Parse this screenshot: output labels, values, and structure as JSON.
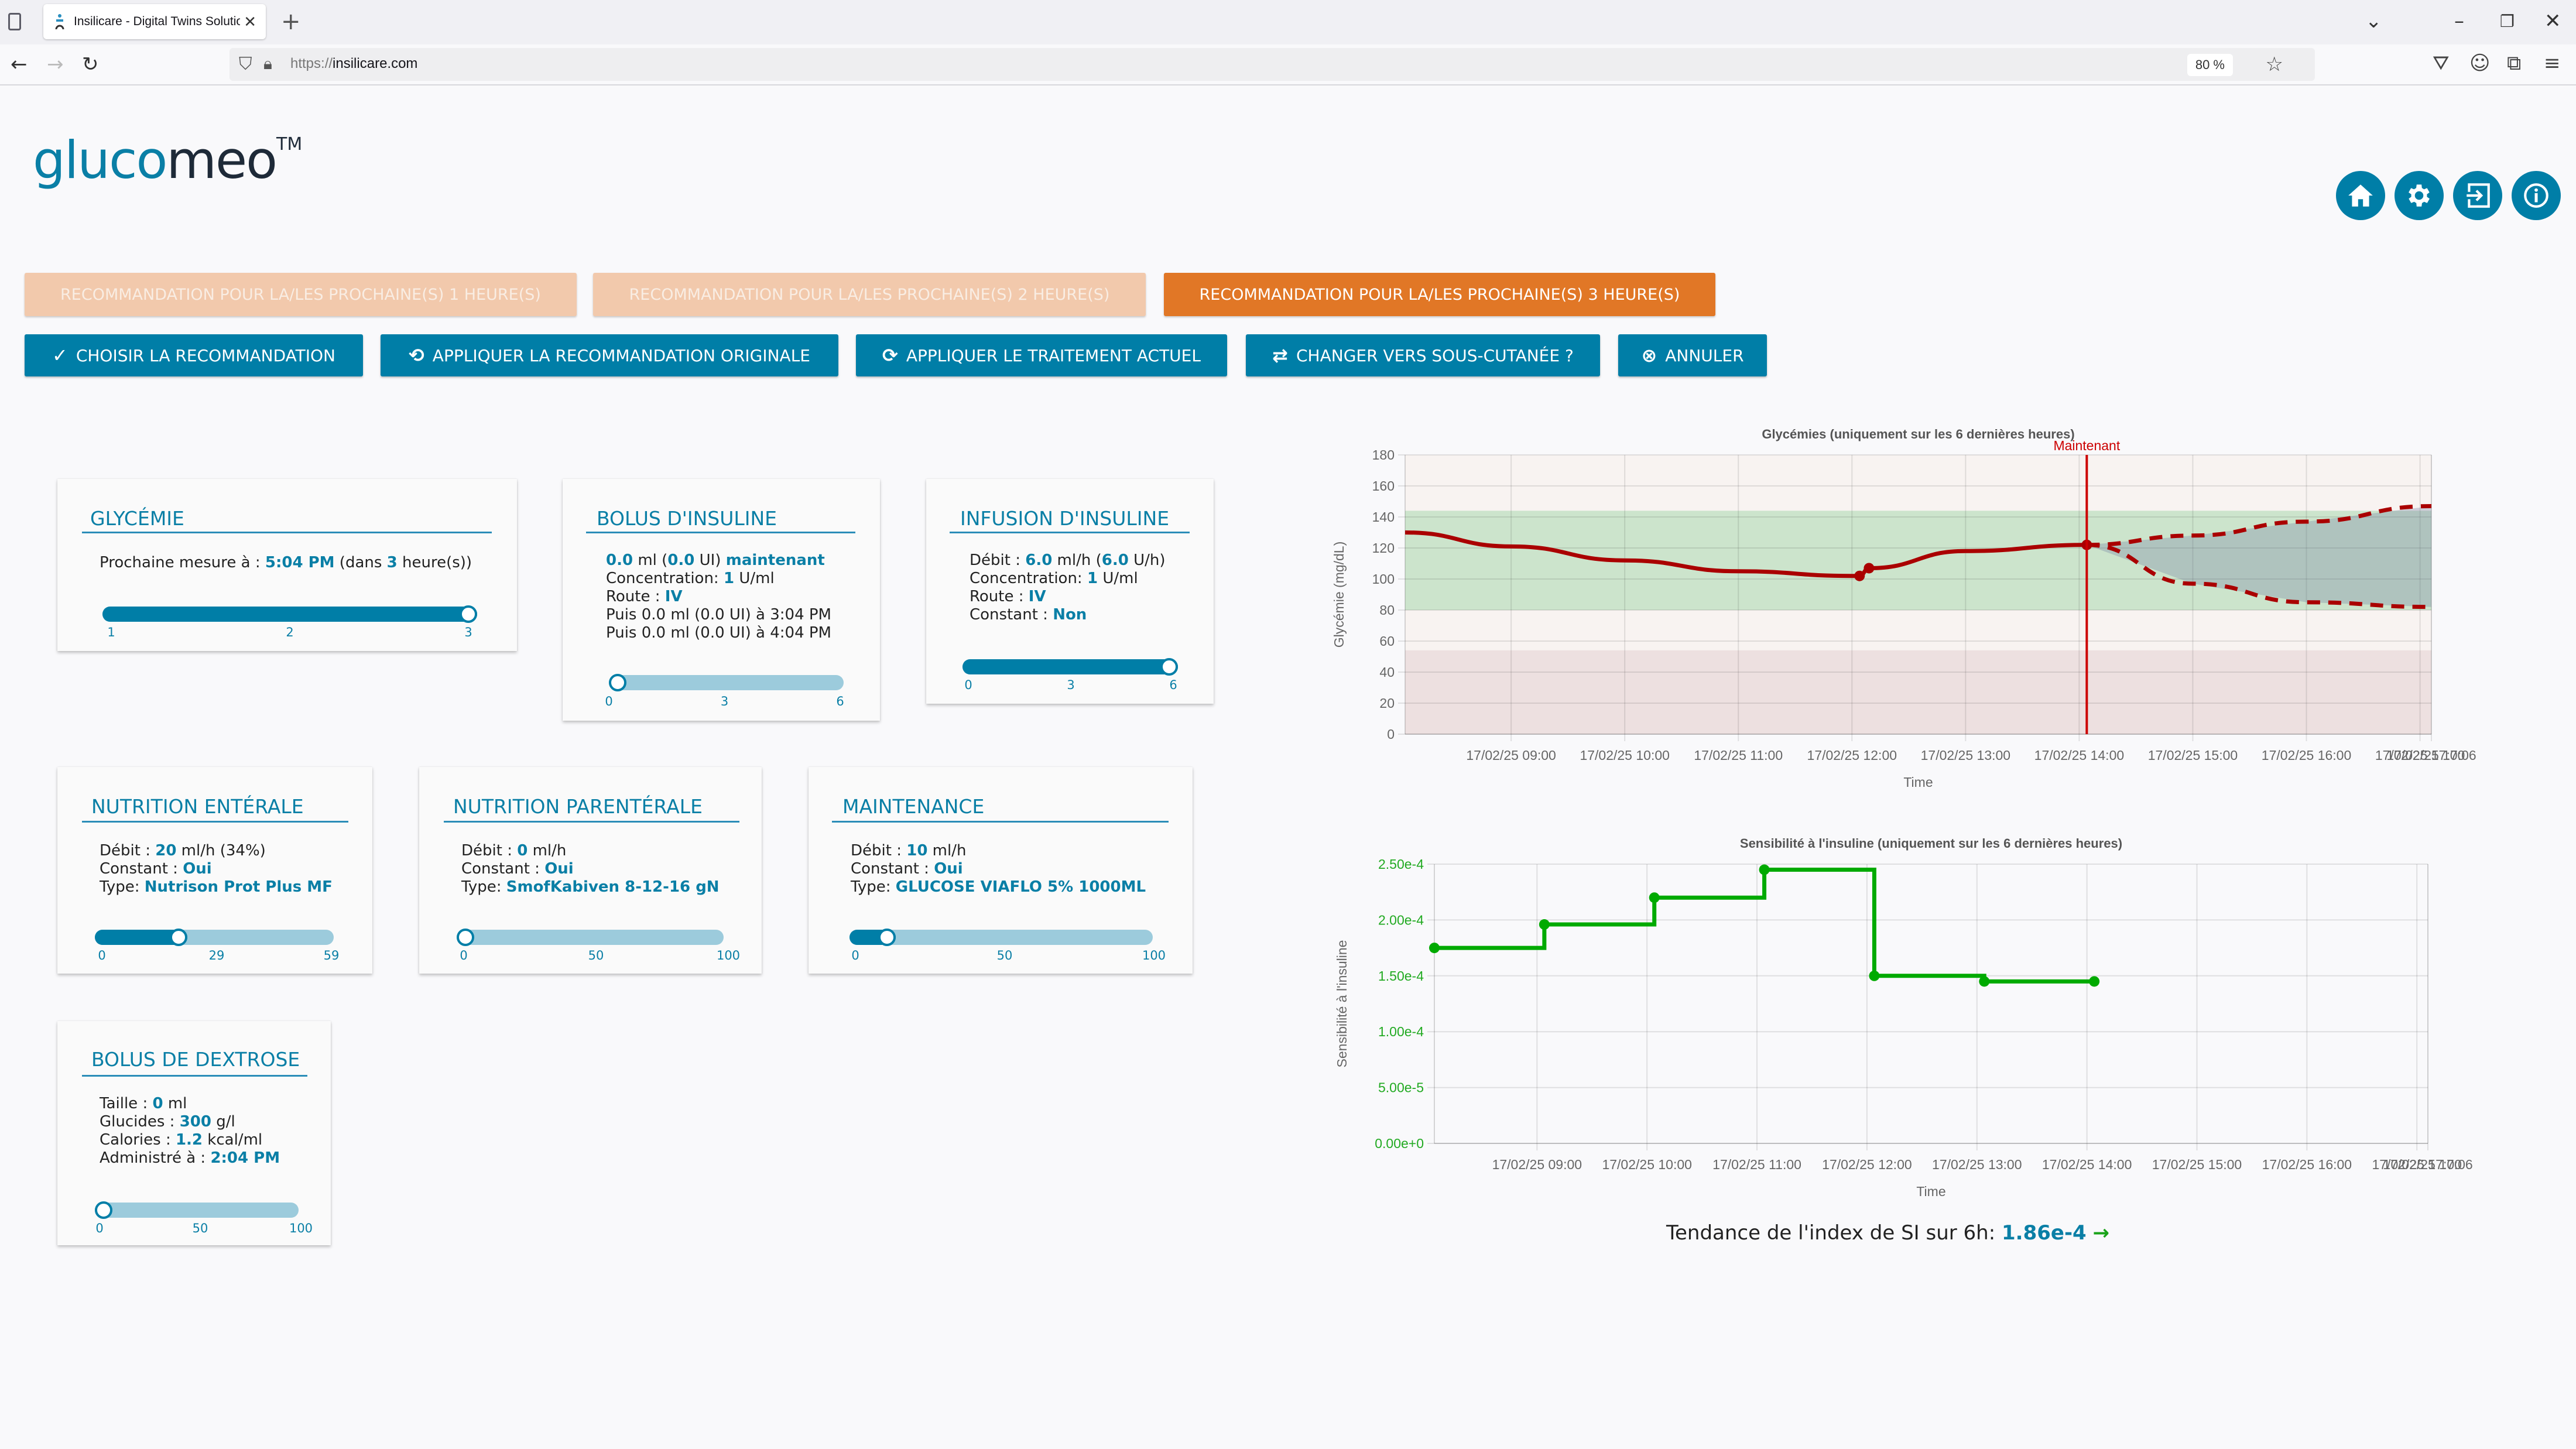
{
  "browser": {
    "tab_title": "Insilicare - Digital Twins Solutio",
    "url_protocol": "https://",
    "url_host": "insilicare.com",
    "zoom_level": "80 %"
  },
  "logo": {
    "part1": "gluco",
    "part2": "meo",
    "tm": "TM"
  },
  "header_icons": [
    "home-icon",
    "gear-icon",
    "login-icon",
    "info-icon"
  ],
  "recommendation_tabs": [
    {
      "label": "RECOMMANDATION POUR LA/LES PROCHAINE(S) 1 HEURE(S)",
      "active": false
    },
    {
      "label": "RECOMMANDATION POUR LA/LES PROCHAINE(S) 2 HEURE(S)",
      "active": false
    },
    {
      "label": "RECOMMANDATION POUR LA/LES PROCHAINE(S) 3 HEURE(S)",
      "active": true
    }
  ],
  "actions": [
    {
      "label": "CHOISIR LA RECOMMANDATION",
      "icon": "check-icon"
    },
    {
      "label": "APPLIQUER LA RECOMMANDATION ORIGINALE",
      "icon": "restore-icon"
    },
    {
      "label": "APPLIQUER LE TRAITEMENT ACTUEL",
      "icon": "refresh-icon"
    },
    {
      "label": "CHANGER VERS SOUS-CUTANÉE ?",
      "icon": "swap-icon"
    },
    {
      "label": "ANNULER",
      "icon": "cancel-circle-icon"
    }
  ],
  "cards": {
    "glycemie": {
      "title": "GLYCÉMIE",
      "line1_prefix": "Prochaine mesure à : ",
      "time": "5:04 PM",
      "mid": " (dans ",
      "hours": "3",
      "suffix": " heure(s))",
      "slider": {
        "min": 1,
        "max": 3,
        "value": 3,
        "ticks": [
          "1",
          "2",
          "3"
        ]
      }
    },
    "bolus_insuline": {
      "title": "BOLUS D'INSULINE",
      "ml": "0.0",
      "ui": "0.0",
      "when": "maintenant",
      "concentration_label": "Concentration: ",
      "concentration": "1",
      "concentration_unit": " U/ml",
      "route_label": "Route : ",
      "route": "IV",
      "then1": "Puis 0.0 ml (0.0 UI) à 3:04 PM",
      "then2": "Puis 0.0 ml (0.0 UI) à 4:04 PM",
      "slider": {
        "min": 0,
        "max": 6,
        "value": 0,
        "ticks": [
          "0",
          "3",
          "6"
        ]
      }
    },
    "infusion_insuline": {
      "title": "INFUSION D'INSULINE",
      "debit_label": "Débit : ",
      "debit_ml": "6.0",
      "debit_uh": "6.0",
      "concentration_label": "Concentration: ",
      "concentration": "1",
      "concentration_unit": " U/ml",
      "route_label": "Route : ",
      "route": "IV",
      "constant_label": "Constant : ",
      "constant": "Non",
      "slider": {
        "min": 0,
        "max": 6,
        "value": 6,
        "ticks": [
          "0",
          "3",
          "6"
        ]
      }
    },
    "nutrition_enterale": {
      "title": "NUTRITION ENTÉRALE",
      "debit_label": "Débit : ",
      "debit": "20",
      "debit_suffix": " ml/h (34%)",
      "constant_label": "Constant : ",
      "constant": "Oui",
      "type_label": "Type: ",
      "type": "Nutrison Prot Plus MF",
      "slider": {
        "min": 0,
        "max": 59,
        "value": 20,
        "ticks": [
          "0",
          "29",
          "59"
        ]
      }
    },
    "nutrition_parenterale": {
      "title": "NUTRITION PARENTÉRALE",
      "debit_label": "Débit : ",
      "debit": "0",
      "debit_suffix": " ml/h",
      "constant_label": "Constant : ",
      "constant": "Oui",
      "type_label": "Type: ",
      "type": "SmofKabiven 8-12-16 gN",
      "slider": {
        "min": 0,
        "max": 100,
        "value": 0,
        "ticks": [
          "0",
          "50",
          "100"
        ]
      }
    },
    "maintenance": {
      "title": "MAINTENANCE",
      "debit_label": "Débit : ",
      "debit": "10",
      "debit_suffix": " ml/h",
      "constant_label": "Constant : ",
      "constant": "Oui",
      "type_label": "Type: ",
      "type": "GLUCOSE VIAFLO 5% 1000ML",
      "slider": {
        "min": 0,
        "max": 100,
        "value": 10,
        "ticks": [
          "0",
          "50",
          "100"
        ]
      }
    },
    "bolus_dextrose": {
      "title": "BOLUS DE DEXTROSE",
      "taille_label": "Taille : ",
      "taille": "0",
      "taille_unit": " ml",
      "glucides_label": "Glucides : ",
      "glucides": "300",
      "glucides_unit": " g/l",
      "calories_label": "Calories : ",
      "calories": "1.2",
      "calories_unit": " kcal/ml",
      "administre_label": "Administré à : ",
      "administre": "2:04 PM",
      "slider": {
        "min": 0,
        "max": 100,
        "value": 0,
        "ticks": [
          "0",
          "50",
          "100"
        ]
      }
    }
  },
  "si_trend": {
    "label": "Tendance de l'index de SI sur 6h: ",
    "value": "1.86e-4",
    "arrow": "→"
  },
  "chart_data": [
    {
      "type": "line",
      "title": "Glycémies (uniquement sur les 6 dernières heures)",
      "xlabel": "Time",
      "ylabel": "Glycémie (mg/dL)",
      "ylim": [
        0,
        180
      ],
      "yticks": [
        0,
        20,
        40,
        60,
        80,
        100,
        120,
        140,
        160,
        180
      ],
      "xlim": [
        "08:04",
        "17:06"
      ],
      "xticks": [
        "09:00",
        "10:00",
        "11:00",
        "12:00",
        "13:00",
        "14:00",
        "15:00",
        "16:00",
        "17:00",
        "17:06"
      ],
      "xtick_labels": [
        "17/02/25 09:00",
        "17/02/25 10:00",
        "17/02/25 11:00",
        "17/02/25 12:00",
        "17/02/25 13:00",
        "17/02/25 14:00",
        "17/02/25 15:00",
        "17/02/25 16:00",
        "17/02/25 17:00",
        "17/02/25 17:06"
      ],
      "grid": true,
      "bands": [
        {
          "name": "target",
          "from": 80,
          "to": 144,
          "color": "#cce4cc"
        },
        {
          "name": "hypo",
          "from": 0,
          "to": 54,
          "color": "#ede0e0"
        }
      ],
      "now_marker": {
        "x": "14:04",
        "label": "Maintenant",
        "color": "#cc0000"
      },
      "series": [
        {
          "name": "measured",
          "style": "solid",
          "color": "#aa0000",
          "x": [
            "08:04",
            "09:00",
            "10:00",
            "11:00",
            "12:00",
            "12:04",
            "12:09",
            "13:00",
            "14:04"
          ],
          "y": [
            130,
            121,
            112,
            105,
            102,
            102,
            107,
            118,
            122
          ],
          "markers": [
            "12:04",
            "12:09",
            "14:04"
          ]
        },
        {
          "name": "forecast-upper",
          "style": "dashed",
          "color": "#aa0000",
          "x": [
            "14:04",
            "15:00",
            "16:00",
            "17:06"
          ],
          "y": [
            122,
            128,
            137,
            147
          ]
        },
        {
          "name": "forecast-lower",
          "style": "dashed",
          "color": "#aa0000",
          "x": [
            "14:04",
            "15:00",
            "16:00",
            "17:06"
          ],
          "y": [
            122,
            97,
            85,
            82
          ]
        }
      ]
    },
    {
      "type": "line",
      "title": "Sensibilité à l'insuline (uniquement sur les 6 dernières heures)",
      "xlabel": "Time",
      "ylabel": "Sensibilité à l'insuline",
      "ylim": [
        0,
        0.00025
      ],
      "yticks": [
        "0.00e+0",
        "5.00e-5",
        "1.00e-4",
        "1.50e-4",
        "2.00e-4",
        "2.50e-4"
      ],
      "xlim": [
        "08:04",
        "17:06"
      ],
      "xticks": [
        "09:00",
        "10:00",
        "11:00",
        "12:00",
        "13:00",
        "14:00",
        "15:00",
        "16:00",
        "17:00",
        "17:06"
      ],
      "xtick_labels": [
        "17/02/25 09:00",
        "17/02/25 10:00",
        "17/02/25 11:00",
        "17/02/25 12:00",
        "17/02/25 13:00",
        "17/02/25 14:00",
        "17/02/25 15:00",
        "17/02/25 16:00",
        "17/02/25 17:00",
        "17/02/25 17:06"
      ],
      "grid": true,
      "step": true,
      "series": [
        {
          "name": "SI",
          "color": "#00aa00",
          "x": [
            "08:04",
            "09:04",
            "10:04",
            "11:04",
            "12:04",
            "13:04",
            "14:04"
          ],
          "y": [
            0.000175,
            0.000196,
            0.00022,
            0.000245,
            0.00015,
            0.000145,
            0.000145
          ]
        }
      ]
    }
  ]
}
